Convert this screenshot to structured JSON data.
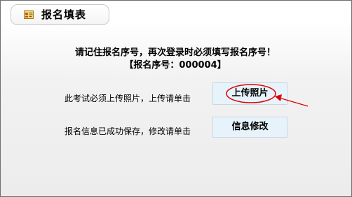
{
  "header": {
    "title": "报名填表",
    "icon": "id-card-icon"
  },
  "notice": {
    "line1": "请记住报名序号，再次登录时必须填写报名序号！",
    "line2": "【报名序号：000004】"
  },
  "upload": {
    "label": "此考试必须上传照片，上传请单击",
    "button": "上传照片"
  },
  "edit": {
    "label": "报名信息已成功保存，修改请单击",
    "button": "信息修改"
  },
  "annotation": {
    "color": "#e00000"
  }
}
